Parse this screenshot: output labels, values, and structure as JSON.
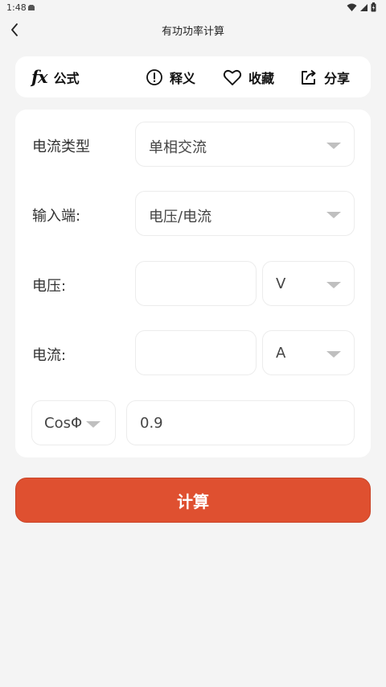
{
  "status": {
    "time": "1:48"
  },
  "header": {
    "title": "有功功率计算"
  },
  "toolbar": {
    "formula_glyph": "fx",
    "formula_label": "公式",
    "explain_label": "释义",
    "favorite_label": "收藏",
    "share_label": "分享"
  },
  "form": {
    "current_type": {
      "label": "电流类型",
      "value": "单相交流"
    },
    "input_side": {
      "label": "输入端:",
      "value": "电压/电流"
    },
    "voltage": {
      "label": "电压:",
      "value": "",
      "unit": "V"
    },
    "current": {
      "label": "电流:",
      "value": "",
      "unit": "A"
    },
    "power_factor": {
      "label": "CosΦ",
      "value": "0.9"
    }
  },
  "actions": {
    "calculate_label": "计算"
  },
  "colors": {
    "accent": "#df5030",
    "background": "#f4f4f4",
    "card": "#ffffff"
  }
}
